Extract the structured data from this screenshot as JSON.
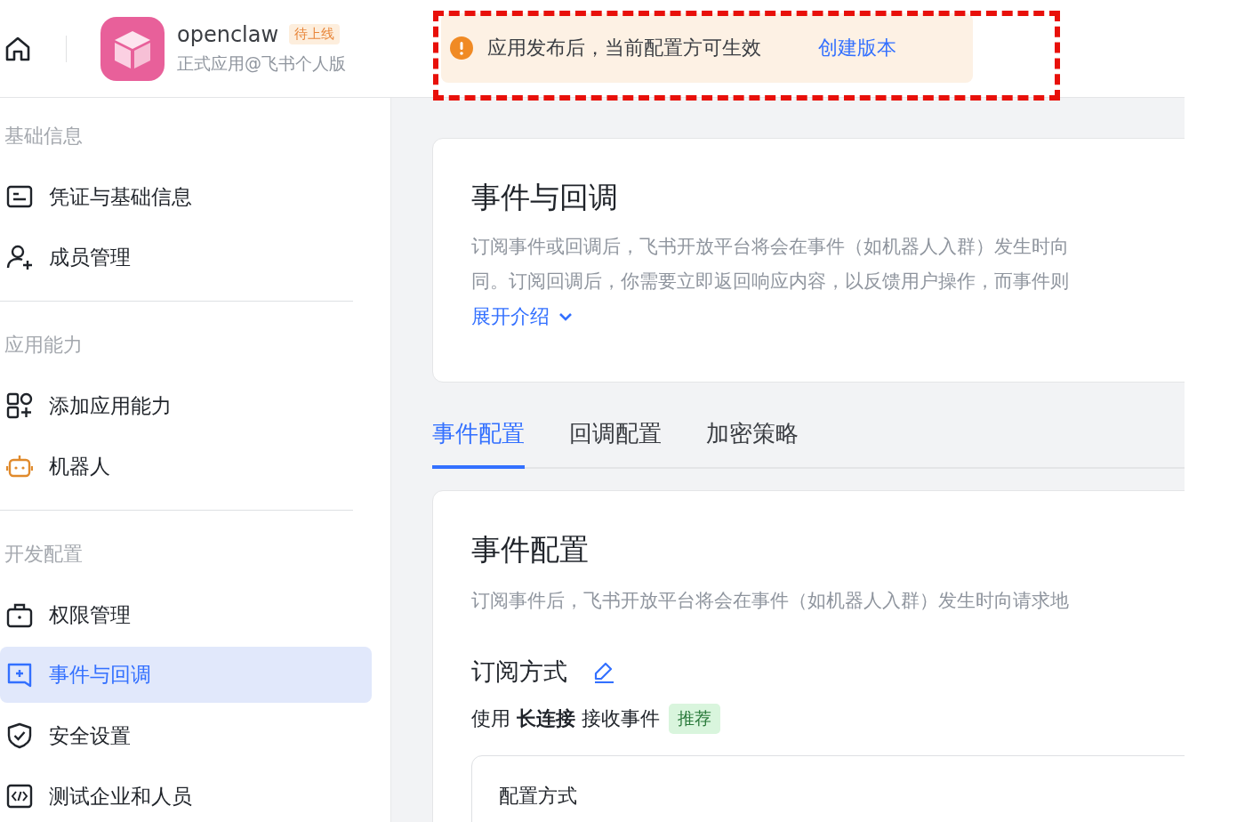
{
  "header": {
    "app_name": "openclaw",
    "status_badge": "待上线",
    "subtitle": "正式应用@飞书个人版"
  },
  "notice": {
    "message": "应用发布后，当前配置方可生效",
    "link": "创建版本"
  },
  "sidebar": {
    "sections": [
      {
        "label": "基础信息",
        "items": [
          {
            "label": "凭证与基础信息",
            "kind": "card",
            "selected": false
          },
          {
            "label": "成员管理",
            "kind": "user-add",
            "selected": false
          }
        ]
      },
      {
        "label": "应用能力",
        "items": [
          {
            "label": "添加应用能力",
            "kind": "apps",
            "selected": false
          },
          {
            "label": "机器人",
            "kind": "robot",
            "selected": false
          }
        ]
      },
      {
        "label": "开发配置",
        "items": [
          {
            "label": "权限管理",
            "kind": "bag",
            "selected": false
          },
          {
            "label": "事件与回调",
            "kind": "event",
            "selected": true
          },
          {
            "label": "安全设置",
            "kind": "shield",
            "selected": false
          },
          {
            "label": "测试企业和人员",
            "kind": "code",
            "selected": false
          }
        ]
      }
    ]
  },
  "intro_card": {
    "title": "事件与回调",
    "description": [
      "订阅事件或回调后，飞书开放平台将会在事件（如机器人入群）发生时向",
      "同。订阅回调后，你需要立即返回响应内容，以反馈用户操作，而事件则"
    ],
    "expand_link": "展开介绍"
  },
  "tabs": [
    {
      "label": "事件配置",
      "selected": true
    },
    {
      "label": "回调配置",
      "selected": false
    },
    {
      "label": "加密策略",
      "selected": false
    }
  ],
  "config_card": {
    "title": "事件配置",
    "description": "订阅事件后，飞书开放平台将会在事件（如机器人入群）发生时向请求地",
    "subscription": {
      "label": "订阅方式",
      "value": "使用 **长连接** 接收事件",
      "tag": "推荐"
    },
    "inner_card": {
      "title": "配置方式"
    }
  }
}
